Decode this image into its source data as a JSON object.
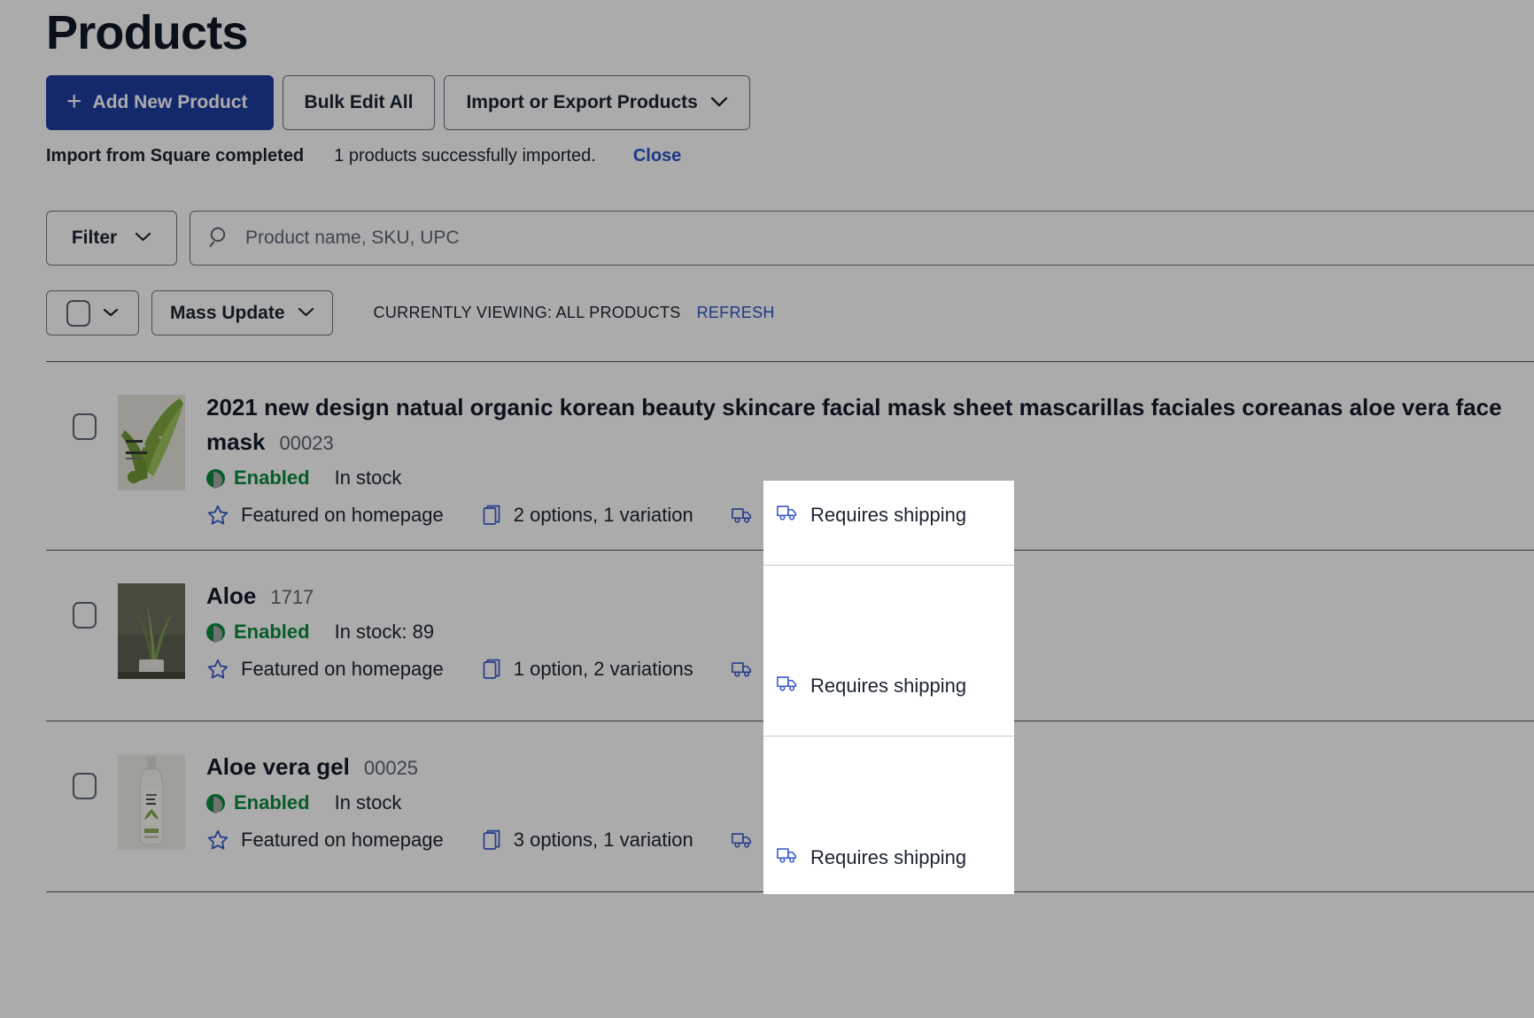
{
  "header": {
    "title": "Products",
    "add_product_label": "Add New Product",
    "add_product_icon": "plus-icon",
    "bulk_edit_label": "Bulk Edit All",
    "import_export_label": "Import or Export Products",
    "import_export_caret": "⌄"
  },
  "notice": {
    "title": "Import from Square completed",
    "message": "1 products successfully imported.",
    "close_label": "Close"
  },
  "toolbar": {
    "filter_label": "Filter",
    "filter_caret": "⌄",
    "search_placeholder": "Product name, SKU, UPC",
    "search_value": "",
    "search_icon": "search-icon",
    "select_all_caret": "⌄",
    "mass_update_label": "Mass Update",
    "mass_update_caret": "⌄",
    "viewing_label": "CURRENTLY VIEWING: ALL PRODUCTS",
    "refresh_label": "REFRESH"
  },
  "products": [
    {
      "title": "2021 new design natual organic korean beauty skincare facial mask sheet mascarillas faciales coreanas aloe vera face mask",
      "sku": "00023",
      "status": "Enabled",
      "stock": "In stock",
      "featured": "Featured on homepage",
      "options": "2 options, 1 variation",
      "shipping": "Requires shipping",
      "thumb": "aloe-mask-sheet-thumbnail"
    },
    {
      "title": "Aloe",
      "sku": "1717",
      "status": "Enabled",
      "stock": "In stock: 89",
      "featured": "Featured on homepage",
      "options": "1 option, 2 variations",
      "shipping": "Requires shipping",
      "thumb": "aloe-plant-thumbnail"
    },
    {
      "title": "Aloe vera gel",
      "sku": "00025",
      "status": "Enabled",
      "stock": "In stock",
      "featured": "Featured on homepage",
      "options": "3 options, 1 variation",
      "shipping": "Requires shipping",
      "thumb": "aloe-vera-gel-bottle-thumbnail"
    }
  ],
  "colors": {
    "primary": "#1f3da1",
    "link": "#2b54c8",
    "enabled": "#0b8a3d",
    "icon_blue": "#3a5ccc",
    "text": "#1b2431",
    "muted": "#5a6472",
    "border": "#4a5667",
    "dim_overlay": "rgba(0,0,0,0.33)"
  }
}
